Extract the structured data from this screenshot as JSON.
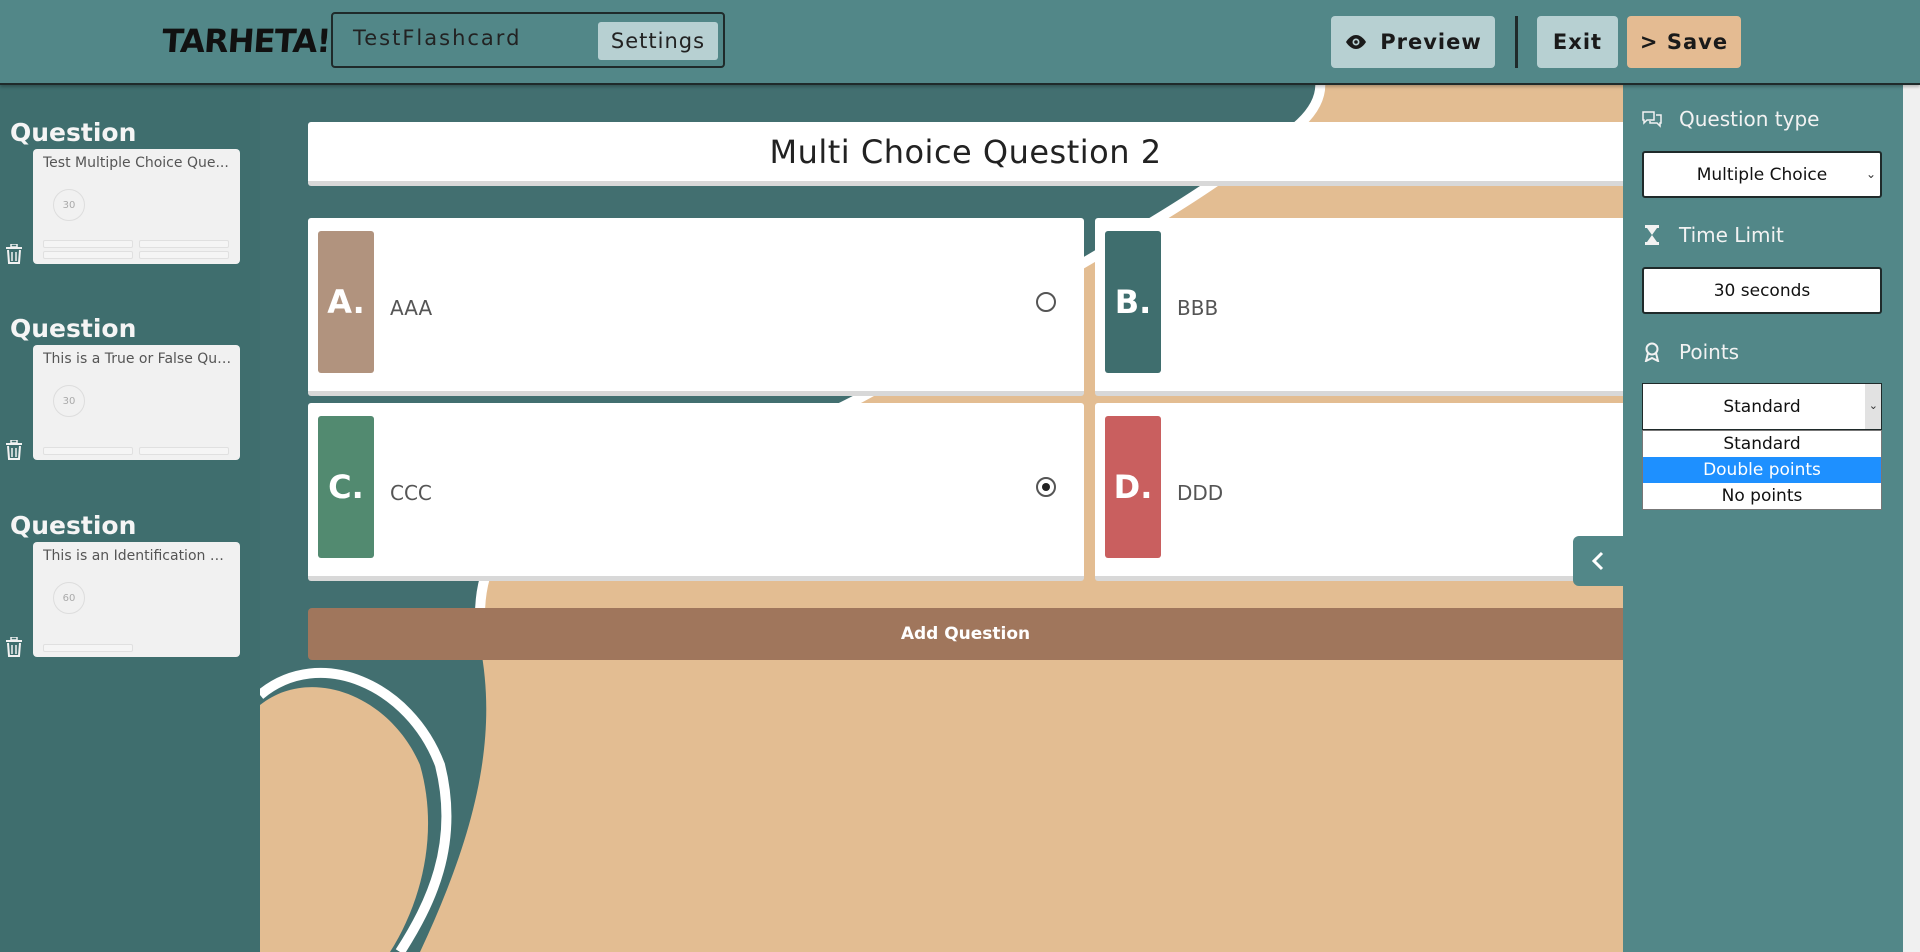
{
  "header": {
    "logo": "TARHETA!",
    "title_value": "TestFlashcard",
    "settings_label": "Settings",
    "preview_label": "Preview",
    "exit_label": "Exit",
    "save_label": "> Save"
  },
  "sidebar": {
    "items": [
      {
        "label": "Question",
        "text": "Test Multiple Choice Que...",
        "time": "30"
      },
      {
        "label": "Question",
        "text": "This is a True or False Que...",
        "time": "30"
      },
      {
        "label": "Question",
        "text": "This is an Identification Q...",
        "time": "60"
      }
    ]
  },
  "main": {
    "question_title": "Multi Choice Question 2",
    "answers": [
      {
        "letter": "A.",
        "text": "AAA",
        "color": "#b1937e",
        "selected": false
      },
      {
        "letter": "B.",
        "text": "BBB",
        "color": "#3f6e6e",
        "selected": false
      },
      {
        "letter": "C.",
        "text": "CCC",
        "color": "#528a70",
        "selected": true
      },
      {
        "letter": "D.",
        "text": "DDD",
        "color": "#c95f5f",
        "selected": false
      }
    ],
    "add_question_label": "Add Question"
  },
  "panel": {
    "question_type_label": "Question type",
    "question_type_value": "Multiple Choice",
    "time_limit_label": "Time Limit",
    "time_limit_value": "30 seconds",
    "points_label": "Points",
    "points_value": "Standard",
    "points_options": [
      "Standard",
      "Double points",
      "No points"
    ],
    "points_highlighted": "Double points"
  },
  "colors": {
    "header": "#528788",
    "sidebar": "#3f6e6e",
    "canvas": "#e3bd92",
    "add_button": "#a0765c",
    "save_button": "#e4bb92",
    "highlight": "#1e90ff"
  }
}
